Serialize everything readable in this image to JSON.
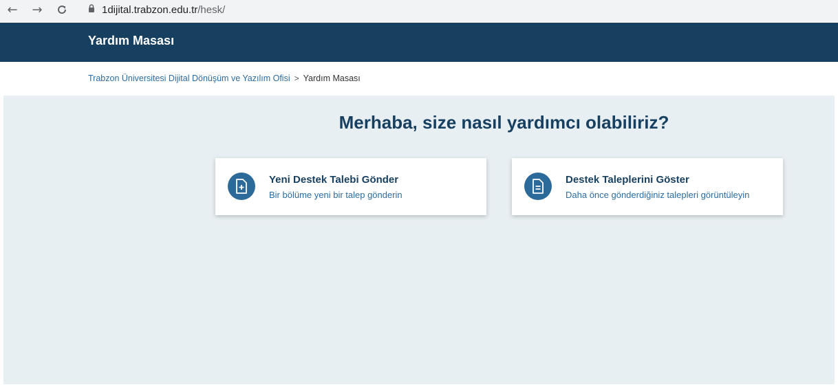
{
  "browser": {
    "back_icon": "back-arrow-icon",
    "forward_icon": "forward-arrow-icon",
    "reload_icon": "reload-icon",
    "url_host": "1dijital.trabzon.edu.tr",
    "url_path": "/hesk/"
  },
  "header": {
    "title": "Yardım Masası",
    "background": "#173f5f"
  },
  "breadcrumb": {
    "parent": "Trabzon Üniversitesi Dijital Dönüşüm ve Yazılım Ofisi",
    "separator": ">",
    "current": "Yardım Masası"
  },
  "main": {
    "heading": "Merhaba, size nasıl yardımcı olabiliriz?",
    "cards": [
      {
        "title": "Yeni Destek Talebi Gönder",
        "description": "Bir bölüme yeni bir talep gönderin",
        "icon": "document-add-icon"
      },
      {
        "title": "Destek Taleplerini Göster",
        "description": "Daha önce gönderdiğiniz talepleri görüntüleyin",
        "icon": "document-list-icon"
      }
    ],
    "accent": "#2c6a9a",
    "background": "#e8eff3"
  }
}
